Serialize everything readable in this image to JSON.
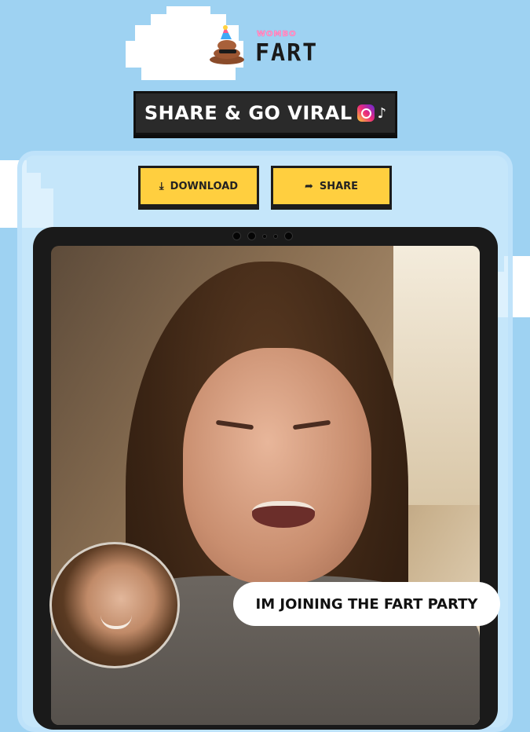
{
  "logo": {
    "brand_small": "WOMBO",
    "brand_big": "FART",
    "icon": "poop-party-hat-icon"
  },
  "banner": {
    "title": "SHARE & GO VIRAL",
    "icons": [
      "instagram-icon",
      "tiktok-icon"
    ]
  },
  "actions": {
    "download_label": "DOWNLOAD",
    "download_icon": "download-icon",
    "share_label": "SHARE",
    "share_icon": "share-arrow-icon"
  },
  "video": {
    "caption": "IM JOINING THE FART PARTY"
  },
  "colors": {
    "background": "#9ed2f2",
    "button": "#ffcf3f",
    "banner": "#2a2a2a",
    "tablet": "#1a1a1a"
  }
}
